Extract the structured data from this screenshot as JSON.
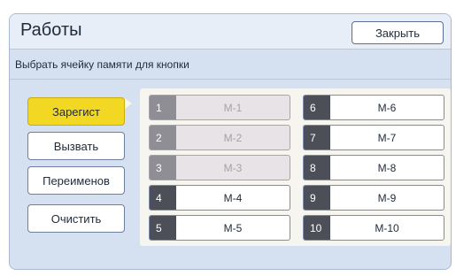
{
  "header": {
    "title": "Работы",
    "close_label": "Закрыть"
  },
  "instruction": "Выбрать ячейку памяти для кнопки",
  "actions": [
    {
      "label": "Зарегист",
      "active": true
    },
    {
      "label": "Вызвать",
      "active": false
    },
    {
      "label": "Переименов",
      "active": false
    },
    {
      "label": "Очистить",
      "active": false
    }
  ],
  "slots": [
    {
      "number": "1",
      "label": "M-1",
      "empty": true
    },
    {
      "number": "2",
      "label": "M-2",
      "empty": true
    },
    {
      "number": "3",
      "label": "M-3",
      "empty": true
    },
    {
      "number": "4",
      "label": "M-4",
      "empty": false
    },
    {
      "number": "5",
      "label": "M-5",
      "empty": false
    },
    {
      "number": "6",
      "label": "M-6",
      "empty": false
    },
    {
      "number": "7",
      "label": "M-7",
      "empty": false
    },
    {
      "number": "8",
      "label": "M-8",
      "empty": false
    },
    {
      "number": "9",
      "label": "M-9",
      "empty": false
    },
    {
      "number": "10",
      "label": "M-10",
      "empty": false
    }
  ],
  "colors": {
    "panel_bg": "#d5e0f0",
    "active_button": "#f3d823",
    "slot_number_bg": "#4c4f58",
    "empty_slot_bg": "#e8e3e6"
  }
}
